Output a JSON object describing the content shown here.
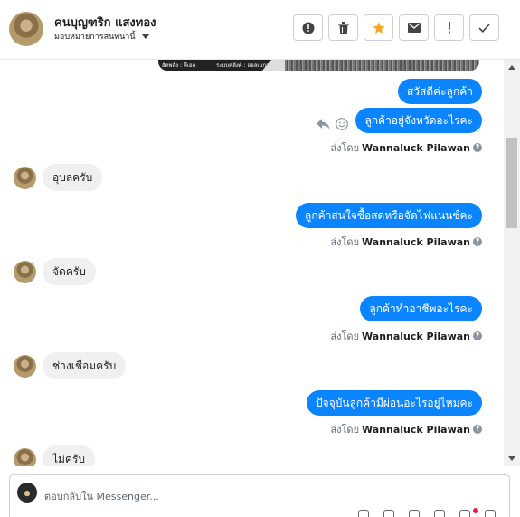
{
  "header": {
    "name": "คนบุญฑริก แสงทอง",
    "assign_label": "มอบหมายการสนทนานี้",
    "actions": [
      {
        "id": "spam",
        "icon": "alert-circle-icon"
      },
      {
        "id": "delete",
        "icon": "trash-icon"
      },
      {
        "id": "star",
        "icon": "star-icon",
        "color": "#f5a623"
      },
      {
        "id": "unread",
        "icon": "envelope-icon"
      },
      {
        "id": "important",
        "icon": "exclamation-icon",
        "color": "#e41e3f"
      },
      {
        "id": "done",
        "icon": "check-icon"
      }
    ]
  },
  "thread": {
    "media_strip": {
      "left_text": "อัดพลัง : คีเอล",
      "right_text": "ระบบคลังค์ : ออลเมกา"
    },
    "messages": [
      {
        "dir": "out",
        "text": "สวัสดีค่ะลูกค้า"
      },
      {
        "dir": "out",
        "text": "ลูกค้าอยู่จังหวัดอะไรคะ",
        "sent_by_prefix": "ส่งโดย",
        "sent_by": "Wannaluck Pilawan"
      },
      {
        "dir": "in",
        "text": "อุบลครับ"
      },
      {
        "dir": "out",
        "text": "ลูกค้าสนใจซื้อสดหรือจัดไฟแนนซ์คะ",
        "sent_by_prefix": "ส่งโดย",
        "sent_by": "Wannaluck Pilawan"
      },
      {
        "dir": "in",
        "text": "จัดครับ"
      },
      {
        "dir": "out",
        "text": "ลูกค้าทำอาชีพอะไรคะ",
        "sent_by_prefix": "ส่งโดย",
        "sent_by": "Wannaluck Pilawan"
      },
      {
        "dir": "in",
        "text": "ช่างเชื่อมครับ"
      },
      {
        "dir": "out",
        "text": "ปัจจุบันลูกค้ามีผ่อนอะไรอยู่ไหมคะ",
        "sent_by_prefix": "ส่งโดย",
        "sent_by": "Wannaluck Pilawan"
      },
      {
        "dir": "in",
        "text": "ไม่ครับ"
      }
    ]
  },
  "composer": {
    "placeholder": "ตอบกลับใน Messenger..."
  },
  "colors": {
    "outgoing_bubble": "#0b84ff",
    "incoming_bubble": "#f0f0f0"
  }
}
